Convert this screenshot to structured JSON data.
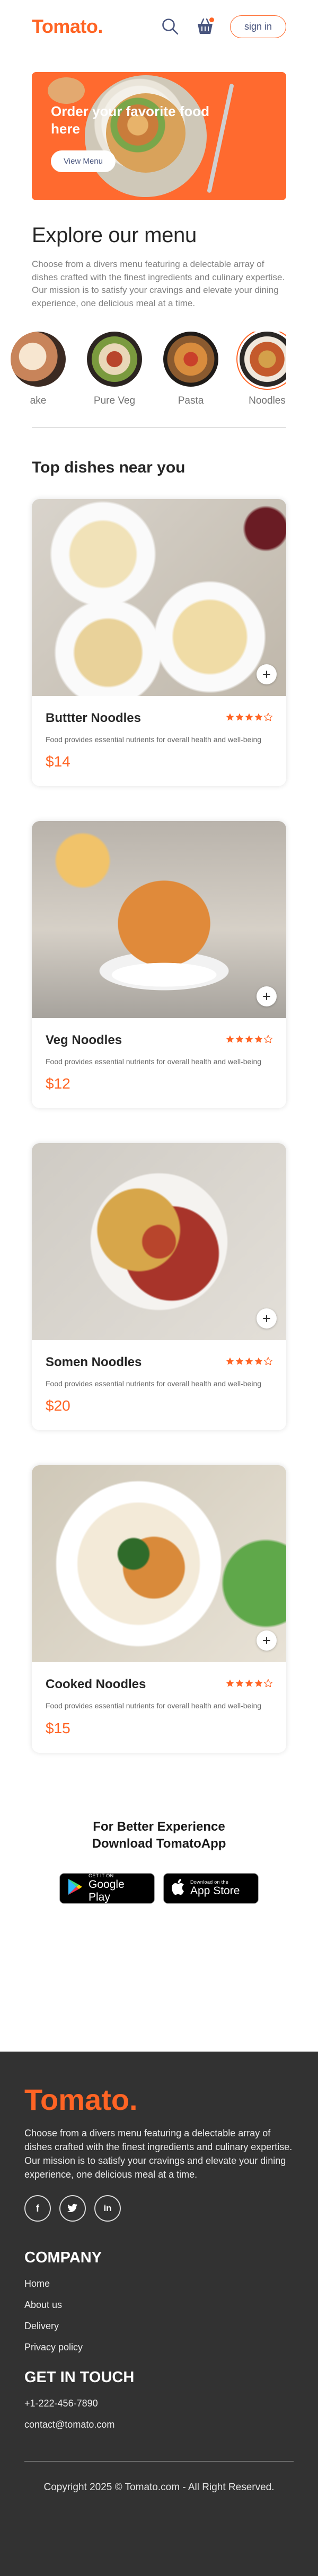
{
  "navbar": {
    "logo": "Tomato.",
    "signin_label": "sign in"
  },
  "hero": {
    "headline": "Order your favorite food here",
    "button_label": "View Menu"
  },
  "explore": {
    "title": "Explore our menu",
    "description": "Choose from a divers menu featuring a delectable array of dishes crafted with the finest ingredients and culinary expertise. Our mission is to satisfy your cravings and elevate your dining experience, one delicious meal at a time.",
    "items": [
      {
        "label": "ake"
      },
      {
        "label": "Pure Veg"
      },
      {
        "label": "Pasta"
      },
      {
        "label": "Noodles"
      }
    ]
  },
  "top_dishes": {
    "title": "Top dishes near you",
    "items": [
      {
        "name": "Buttter Noodles",
        "rating": 4,
        "description": "Food provides essential nutrients for overall health and well-being",
        "price": "$14"
      },
      {
        "name": "Veg Noodles",
        "rating": 4,
        "description": "Food provides essential nutrients for overall health and well-being",
        "price": "$12"
      },
      {
        "name": "Somen Noodles",
        "rating": 4,
        "description": "Food provides essential nutrients for overall health and well-being",
        "price": "$20"
      },
      {
        "name": "Cooked Noodles",
        "rating": 4,
        "description": "Food provides essential nutrients for overall health and well-being",
        "price": "$15"
      }
    ]
  },
  "app_download": {
    "title": "For Better Experience Download TomatoApp",
    "google_small": "GET IT ON",
    "google_big": "Google Play",
    "apple_small": "Download on the",
    "apple_big": "App Store"
  },
  "footer": {
    "logo": "Tomato.",
    "description": "Choose from a divers menu featuring a delectable array of dishes crafted with the finest ingredients and culinary expertise. Our mission is to satisfy your cravings and elevate your dining experience, one delicious meal at a time.",
    "company_title": "COMPANY",
    "company_links": [
      "Home",
      "About us",
      "Delivery",
      "Privacy policy"
    ],
    "contact_title": "GET IN TOUCH",
    "phone": "+1-222-456-7890",
    "email": "contact@tomato.com",
    "copyright": "Copyright 2025 © Tomato.com - All Right Reserved."
  },
  "colors": {
    "accent": "#ff6424",
    "footer_bg": "#323232",
    "star_filled": "#ff6424"
  }
}
